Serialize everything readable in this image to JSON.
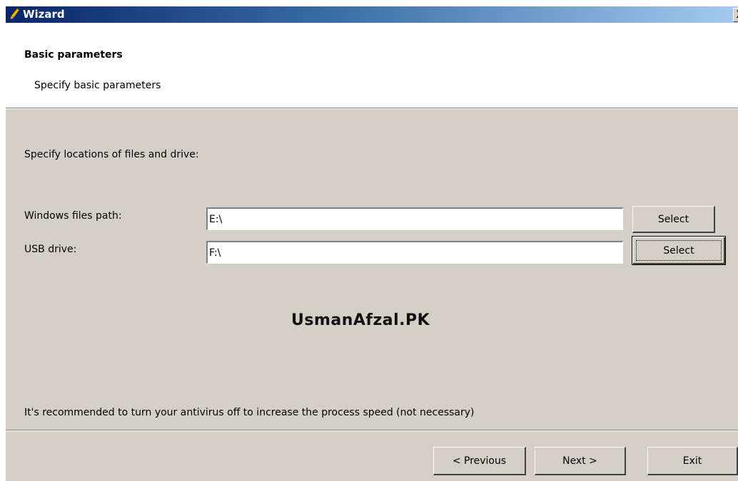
{
  "window": {
    "title": "Wizard",
    "close_glyph": "X",
    "icon": "pencil-icon"
  },
  "header": {
    "title": "Basic parameters",
    "subtitle": "Specify basic parameters"
  },
  "main": {
    "instruction": "Specify locations of files and drive:",
    "windows_path": {
      "label": "Windows files path:",
      "value": "E:\\",
      "button_label": "Select"
    },
    "usb_drive": {
      "label": "USB drive:",
      "value": "F:\\",
      "button_label": "Select"
    },
    "watermark": "UsmanAfzal.PK",
    "note": "It's recommended to turn your antivirus off to increase the process speed (not necessary)"
  },
  "footer": {
    "previous_label": "< Previous",
    "next_label": "Next >",
    "exit_label": "Exit"
  },
  "colors": {
    "titlebar_start": "#0a246a",
    "titlebar_end": "#a6caf0",
    "dialog_face": "#d4d0c8"
  }
}
